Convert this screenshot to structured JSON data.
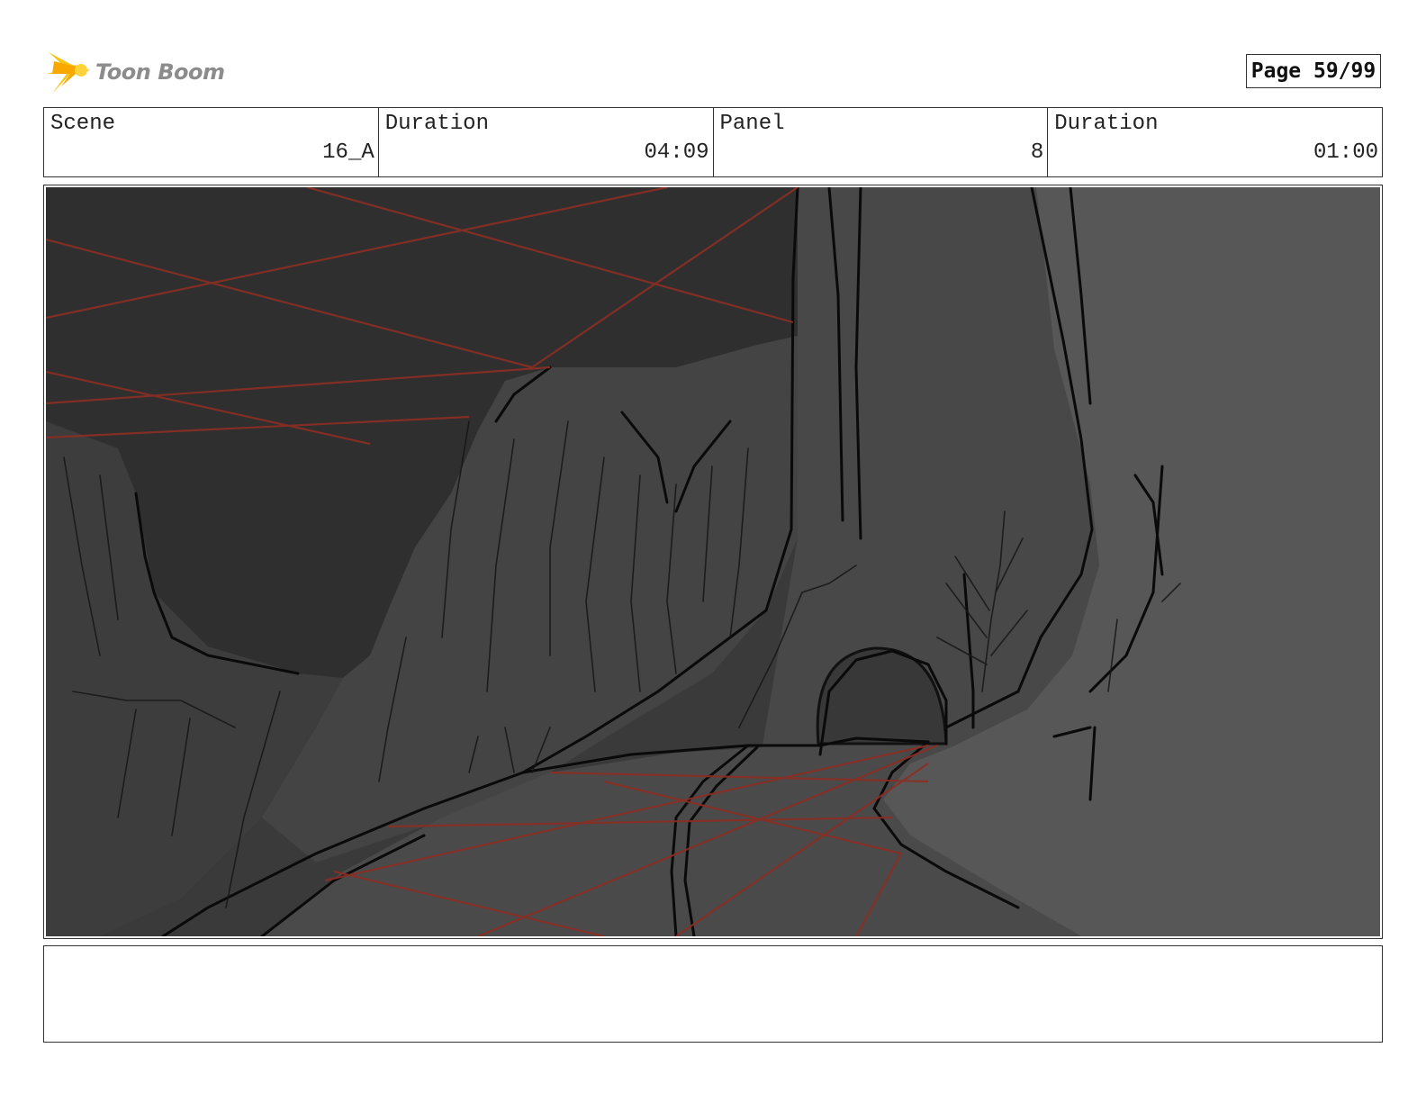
{
  "logo": {
    "text": "Toon Boom",
    "icon": "starburst-logo-icon",
    "color": "#f5c518"
  },
  "page": {
    "label": "Page 59/99"
  },
  "info": {
    "scene_label": "Scene",
    "scene_value": "16_A",
    "scene_duration_label": "Duration",
    "scene_duration_value": "04:09",
    "panel_label": "Panel",
    "panel_value": "8",
    "panel_duration_label": "Duration",
    "panel_duration_value": "01:00"
  },
  "panel_image": {
    "description": "grayscale storyboard sketch of a canyon road leading to a tunnel with red perspective guide lines",
    "guide_color": "#8b2e24"
  },
  "notes": {
    "text": ""
  }
}
